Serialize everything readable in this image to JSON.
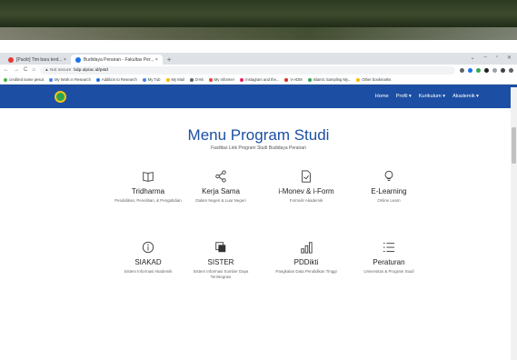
{
  "browser": {
    "tabs": [
      {
        "label": "[Pacitr] Tim baru terd... ×",
        "favicon_color": "#e53935",
        "active": false
      },
      {
        "label": "Budidaya Perairan - Fakultas Per... ×",
        "favicon_color": "#1a73e8",
        "active": true
      }
    ],
    "new_tab": "+",
    "window_controls": [
      "⌄",
      "–",
      "▫",
      "✕"
    ],
    "nav": {
      "back": "←",
      "forward": "→",
      "reload": "C",
      "home": "⌂"
    },
    "address": {
      "security": "▲ Not secure",
      "url": "bdp.ulp/ac.id/pstd"
    },
    "bookmarks": [
      {
        "label": "credited name pesut",
        "color": "#4caf50"
      },
      {
        "label": "My Work in Research",
        "color": "#4285f4"
      },
      {
        "label": "Addition to Research",
        "color": "#1a73e8"
      },
      {
        "label": "My Tub",
        "color": "#4285f4"
      },
      {
        "label": "My Mail",
        "color": "#fbbc05"
      },
      {
        "label": "D-Mi",
        "color": "#5f6368"
      },
      {
        "label": "My Informer",
        "color": "#ea4335"
      },
      {
        "label": "Instagram and the...",
        "color": "#e91e63"
      },
      {
        "label": "V-ADM",
        "color": "#d93025"
      },
      {
        "label": "Islamic Sampling My...",
        "color": "#34a853"
      },
      {
        "label": "Other bookmarks",
        "color": "#fbbc05"
      }
    ]
  },
  "site_nav": {
    "links": [
      "Home",
      "Profil ▾",
      "Kurikulum ▾",
      "Akademik ▾"
    ]
  },
  "page": {
    "title": "Menu Program Studi",
    "subtitle": "Fasilitas Link Program Studi Budidaya Perairan",
    "menu_items": [
      {
        "name": "tridharma",
        "icon": "book-icon",
        "label": "Tridharma",
        "desc": "Pendidikan, Penelitian, & Pengabdian"
      },
      {
        "name": "kerja-sama",
        "icon": "share-icon",
        "label": "Kerja Sama",
        "desc": "Dalam Negeri & Luar Negeri"
      },
      {
        "name": "i-monev",
        "icon": "document-icon",
        "label": "i-Monev & i-Form",
        "desc": "Formulir Akademik"
      },
      {
        "name": "e-learning",
        "icon": "lightbulb-icon",
        "label": "E-Learning",
        "desc": "Online Learn"
      },
      {
        "name": "siakad",
        "icon": "info-icon",
        "label": "SIAKAD",
        "desc": "Sistem Informasi Akademik"
      },
      {
        "name": "sister",
        "icon": "copy-icon",
        "label": "SISTER",
        "desc": "Sistem Informasi Sumber Daya Terintegrasi"
      },
      {
        "name": "pddikti",
        "icon": "bar-chart-icon",
        "label": "PDDikti",
        "desc": "Pangkalan Data Pendidikan Tinggi"
      },
      {
        "name": "peraturan",
        "icon": "list-icon",
        "label": "Peraturan",
        "desc": "Universitas & Program Studi"
      }
    ]
  },
  "colors": {
    "navbar": "#1c4fa3",
    "title": "#1c4fa3",
    "logo_ring": "#f5c518",
    "logo_fill": "#2ea44f"
  }
}
